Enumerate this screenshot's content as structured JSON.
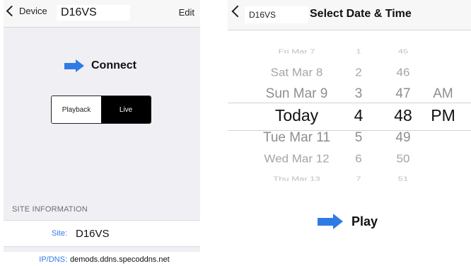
{
  "left": {
    "nav": {
      "back_label": "Device",
      "device_name": "D16VS",
      "edit_label": "Edit"
    },
    "connect": {
      "label": "Connect",
      "arrow_color": "#2f7be6"
    },
    "segmented": {
      "options": [
        "Playback",
        "Live"
      ],
      "selected": "Live"
    },
    "site_info": {
      "header": "SITE INFORMATION",
      "site_label": "Site:",
      "site_value": "D16VS",
      "ip_label": "IP/DNS:",
      "ip_value": "demods.ddns.specoddns.net"
    }
  },
  "right": {
    "nav": {
      "device_name": "D16VS",
      "title": "Select Date & Time"
    },
    "picker": {
      "rows": [
        {
          "date": "Fri Mar 7",
          "hour": "1",
          "minute": "45",
          "ampm": ""
        },
        {
          "date": "Sat Mar 8",
          "hour": "2",
          "minute": "46",
          "ampm": ""
        },
        {
          "date": "Sun Mar 9",
          "hour": "3",
          "minute": "47",
          "ampm": "AM"
        },
        {
          "date": "Today",
          "hour": "4",
          "minute": "48",
          "ampm": "PM"
        },
        {
          "date": "Tue Mar 11",
          "hour": "5",
          "minute": "49",
          "ampm": ""
        },
        {
          "date": "Wed Mar 12",
          "hour": "6",
          "minute": "50",
          "ampm": ""
        },
        {
          "date": "Thu Mar 13",
          "hour": "7",
          "minute": "51",
          "ampm": ""
        }
      ],
      "selected_index": 3
    },
    "play": {
      "label": "Play",
      "arrow_color": "#2f7be6"
    }
  }
}
